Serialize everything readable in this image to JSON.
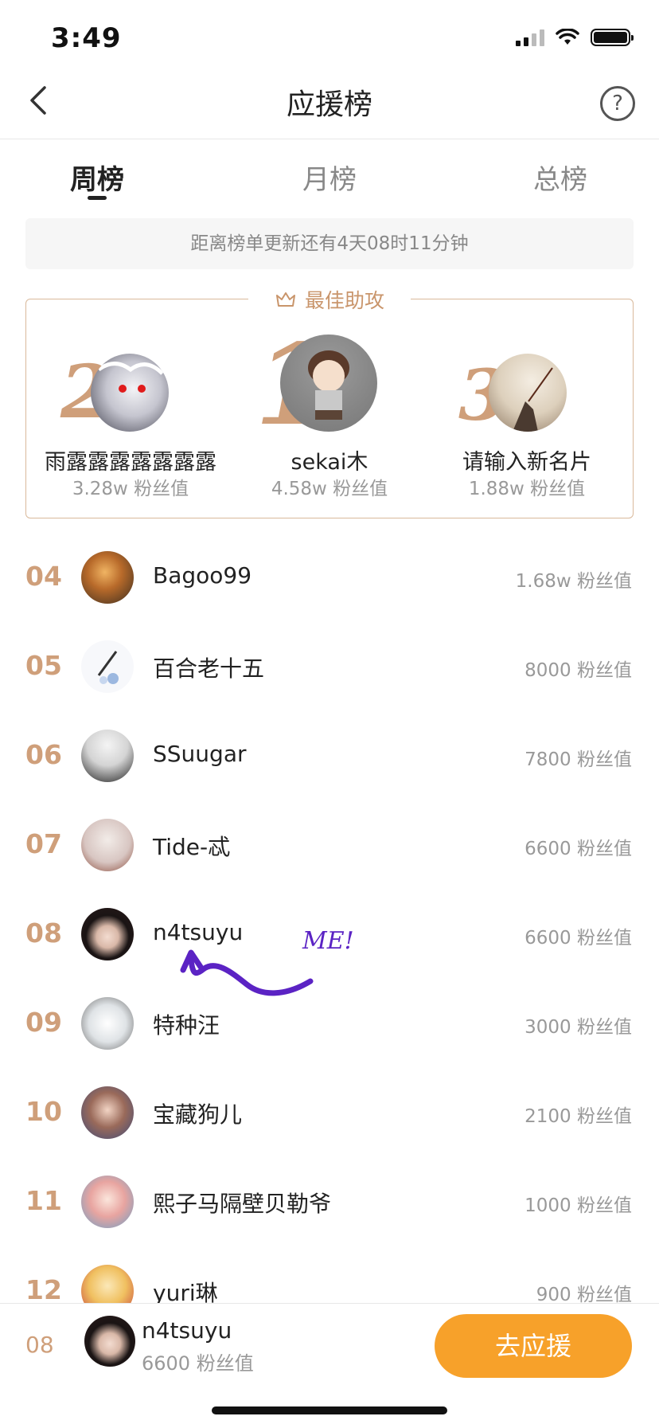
{
  "status": {
    "time": "3:49"
  },
  "nav": {
    "title": "应援榜",
    "help": "?"
  },
  "tabs": [
    {
      "label": "周榜",
      "active": true
    },
    {
      "label": "月榜",
      "active": false
    },
    {
      "label": "总榜",
      "active": false
    }
  ],
  "countdown": "距离榜单更新还有4天08时11分钟",
  "top3": {
    "header": "最佳助攻",
    "first": {
      "rank": "1",
      "name": "sekai木",
      "score": "4.58w 粉丝值"
    },
    "second": {
      "rank": "2",
      "name": "雨露露露露露露露",
      "score": "3.28w 粉丝值"
    },
    "third": {
      "rank": "3",
      "name": "请输入新名片",
      "score": "1.88w 粉丝值"
    }
  },
  "list": [
    {
      "rank": "04",
      "name": "Bagoo99",
      "score": "1.68w 粉丝值"
    },
    {
      "rank": "05",
      "name": "百合老十五",
      "score": "8000 粉丝值"
    },
    {
      "rank": "06",
      "name": "SSuugar",
      "score": "7800 粉丝值"
    },
    {
      "rank": "07",
      "name": "Tide-忒",
      "score": "6600 粉丝值"
    },
    {
      "rank": "08",
      "name": "n4tsuyu",
      "score": "6600 粉丝值"
    },
    {
      "rank": "09",
      "name": "特种汪",
      "score": "3000 粉丝值"
    },
    {
      "rank": "10",
      "name": "宝藏狗儿",
      "score": "2100 粉丝值"
    },
    {
      "rank": "11",
      "name": "熙子马隔壁贝勒爷",
      "score": "1000 粉丝值"
    },
    {
      "rank": "12",
      "name": "yuri琳",
      "score": "900 粉丝值"
    }
  ],
  "annotation": {
    "text": "ME!"
  },
  "me": {
    "rank": "08",
    "name": "n4tsuyu",
    "score": "6600 粉丝值"
  },
  "cheer_button": "去应援",
  "colors": {
    "accent": "#cf9f7a",
    "button": "#f7a12a",
    "annotation": "#5b23c4"
  },
  "icons": [
    "back-arrow-icon",
    "help-icon",
    "crown-icon",
    "signal-icon",
    "wifi-icon",
    "battery-icon"
  ]
}
